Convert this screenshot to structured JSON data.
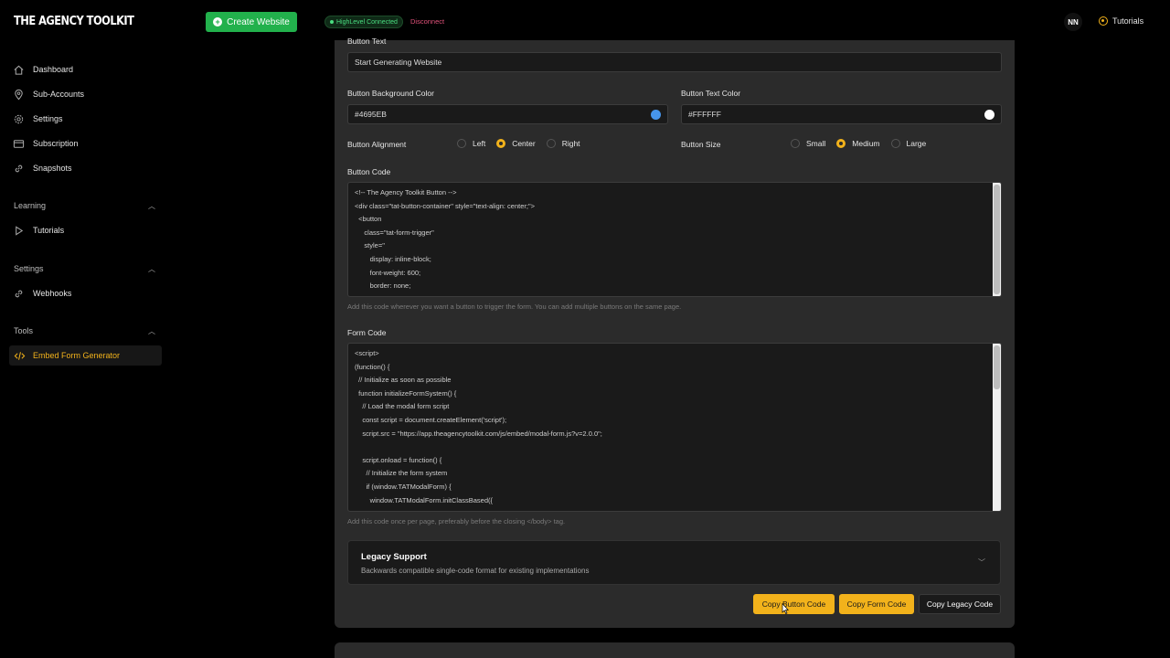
{
  "header": {
    "logo": "THE AGENCY TOOLKIT",
    "create_button": "Create Website",
    "connection_badge": "HighLevel Connected",
    "disconnect": "Disconnect",
    "avatar_initials": "NN",
    "tutorials": "Tutorials"
  },
  "sidebar": {
    "items": [
      {
        "label": "Dashboard",
        "icon": "home-icon"
      },
      {
        "label": "Sub-Accounts",
        "icon": "location-pin-icon"
      },
      {
        "label": "Settings",
        "icon": "gear-icon"
      },
      {
        "label": "Subscription",
        "icon": "credit-card-icon"
      },
      {
        "label": "Snapshots",
        "icon": "link-icon"
      }
    ],
    "learning_header": "Learning",
    "learning_items": [
      {
        "label": "Tutorials",
        "icon": "play-icon"
      }
    ],
    "settings_header": "Settings",
    "settings_items": [
      {
        "label": "Webhooks",
        "icon": "webhook-icon"
      }
    ],
    "tools_header": "Tools",
    "tools_items": [
      {
        "label": "Embed Form Generator",
        "icon": "code-icon"
      }
    ]
  },
  "form": {
    "button_text_label": "Button Text",
    "button_text_value": "Start Generating Website",
    "bg_color_label": "Button Background Color",
    "bg_color_value": "#4695EB",
    "text_color_label": "Button Text Color",
    "text_color_value": "#FFFFFF",
    "alignment_label": "Button Alignment",
    "alignment_options": [
      "Left",
      "Center",
      "Right"
    ],
    "alignment_selected": "Center",
    "size_label": "Button Size",
    "size_options": [
      "Small",
      "Medium",
      "Large"
    ],
    "size_selected": "Medium",
    "button_code_label": "Button Code",
    "button_code": "<!-- The Agency Toolkit Button -->\n<div class=\"tat-button-container\" style=\"text-align: center;\">\n  <button\n     class=\"tat-form-trigger\"\n     style=\"\n        display: inline-block;\n        font-weight: 600;\n        border: none;",
    "button_code_hint": "Add this code wherever you want a button to trigger the form. You can add multiple buttons on the same page.",
    "form_code_label": "Form Code",
    "form_code": "<script>\n(function() {\n  // Initialize as soon as possible\n  function initializeFormSystem() {\n    // Load the modal form script\n    const script = document.createElement('script');\n    script.src = \"https://app.theagencytoolkit.com/js/embed/modal-form.js?v=2.0.0\";\n\n    script.onload = function() {\n      // Initialize the form system\n      if (window.TATModalForm) {\n        window.TATModalForm.initClassBased({",
    "form_code_hint": "Add this code once per page, preferably before the closing </body> tag."
  },
  "legacy": {
    "title": "Legacy Support",
    "subtitle": "Backwards compatible single-code format for existing implementations"
  },
  "actions": {
    "copy_button": "Copy Button Code",
    "copy_form": "Copy Form Code",
    "copy_legacy": "Copy Legacy Code"
  },
  "colors": {
    "accent": "#f2b21b",
    "green": "#22b14c",
    "swatch_bg": "#4695EB",
    "swatch_text": "#FFFFFF"
  }
}
